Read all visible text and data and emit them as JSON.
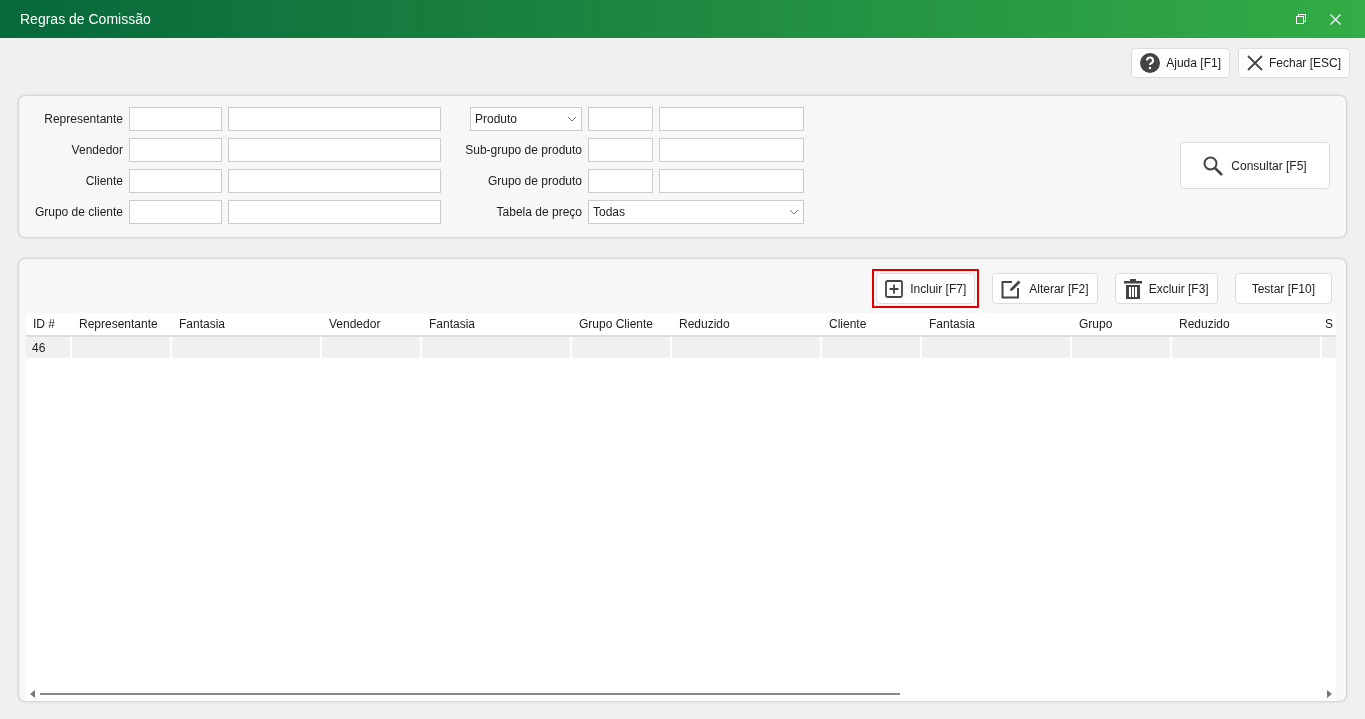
{
  "window": {
    "title": "Regras de Comissão"
  },
  "top_buttons": [
    {
      "kind": "help",
      "label": "Ajuda [F1]"
    },
    {
      "kind": "close",
      "label": "Fechar [ESC]"
    }
  ],
  "filters_left": [
    {
      "label": "Representante"
    },
    {
      "label": "Vendedor"
    },
    {
      "label": "Cliente"
    },
    {
      "label": "Grupo de cliente"
    }
  ],
  "filters_right": [
    {
      "kind": "dropdown-pair",
      "value": "Produto"
    },
    {
      "kind": "pair",
      "label": "Sub-grupo de produto"
    },
    {
      "kind": "pair",
      "label": "Grupo de produto"
    },
    {
      "kind": "select",
      "label": "Tabela de preço",
      "value": "Todas"
    }
  ],
  "search_button": {
    "label": "Consultar [F5]"
  },
  "toolbar": [
    {
      "kind": "add",
      "label": "Incluir [F7]",
      "highlighted": true
    },
    {
      "kind": "edit",
      "label": "Alterar [F2]",
      "highlighted": false
    },
    {
      "kind": "delete",
      "label": "Excluir [F3]",
      "highlighted": false
    },
    {
      "kind": "text",
      "label": "Testar [F10]",
      "highlighted": false
    }
  ],
  "table": {
    "columns": [
      "ID #",
      "Representante",
      "Fantasia",
      "Vendedor",
      "Fantasia",
      "Grupo Cliente",
      "Reduzido",
      "Cliente",
      "Fantasia",
      "Grupo",
      "Reduzido",
      "S"
    ],
    "rows": [
      [
        "46"
      ]
    ]
  }
}
